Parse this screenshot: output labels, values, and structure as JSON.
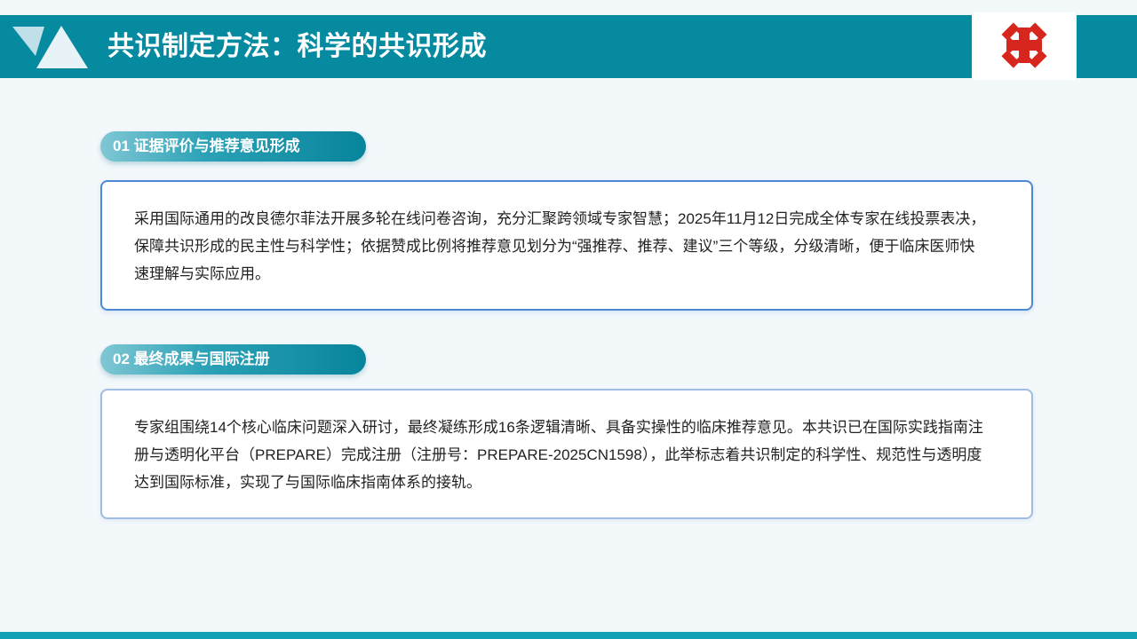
{
  "header": {
    "title": "共识制定方法：科学的共识形成"
  },
  "sections": [
    {
      "label": "01 证据评价与推荐意见形成",
      "text": "采用国际通用的改良德尔菲法开展多轮在线问卷咨询，充分汇聚跨领域专家智慧；2025年11月12日完成全体专家在线投票表决，保障共识形成的民主性与科学性；依据赞成比例将推荐意见划分为“强推荐、推荐、建议”三个等级，分级清晰，便于临床医师快速理解与实际应用。"
    },
    {
      "label": "02 最终成果与国际注册",
      "text": "专家组围绕14个核心临床问题深入研讨，最终凝练形成16条逻辑清晰、具备实操性的临床推荐意见。本共识已在国际实践指南注册与透明化平台（PREPARE）完成注册（注册号：PREPARE-2025CN1598），此举标志着共识制定的科学性、规范性与透明度达到国际标准，实现了与国际临床指南体系的接轨。"
    }
  ],
  "colors": {
    "header": "#068aa0",
    "logo_red": "#d7261e",
    "card_border_primary": "#4d89d6",
    "card_border_secondary": "#9fbde2",
    "bottom_bar": "#12a1b5"
  },
  "icons": {
    "logo": "red-cross-emblem-icon",
    "header_decoration": "triangle-decoration-icon"
  }
}
